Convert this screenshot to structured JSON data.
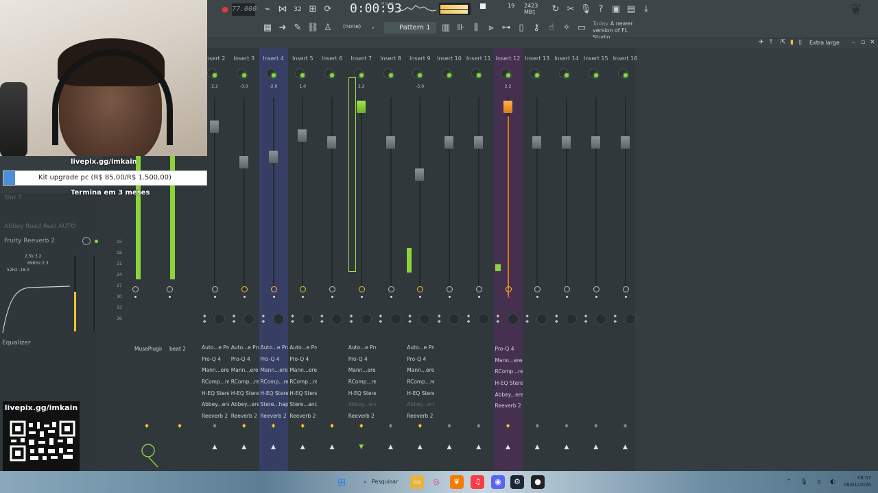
{
  "toolbar": {
    "tempo": "77.000",
    "pattern_number": "32",
    "time": "0:00:93",
    "time_label": "M:S:CS",
    "cpu_value": "19",
    "memory": "2423 MB",
    "polyphony": "1",
    "none_label": "(none)",
    "pattern": "Pattern 1",
    "news_today": "Today",
    "news_message": "A newer version of FL Studio..."
  },
  "mixer": {
    "zoom": "Extra large",
    "tracks": [
      {
        "name": "Insert 2",
        "pan": "2.2",
        "fx": [
          "MusePlugin"
        ],
        "dim_fx": [],
        "highlight": "",
        "fader": 0.78,
        "cap": "grey",
        "level": 0.62,
        "yellow_return": false,
        "yellow_send": true,
        "led": false
      },
      {
        "name": "Insert 3",
        "pan": "-3.0",
        "fx": [
          "beat 2"
        ],
        "dim_fx": [],
        "highlight": "",
        "fader": 0.65,
        "cap": "grey",
        "level": 0.62,
        "yellow_return": false,
        "yellow_send": true,
        "led": true
      },
      {
        "name": "Insert 4",
        "pan": "-2.0",
        "fx": [
          "Auto...e Pro",
          "Pro-Q 4",
          "Mann...ereo",
          "RComp...reo",
          "H-EQ Stereo",
          "Abbey...ereo",
          "Reeverb 2"
        ],
        "dim_fx": [],
        "highlight": "blue",
        "fader": 0.68,
        "cap": "grey",
        "level": 0,
        "yellow_return": true,
        "yellow_send": true,
        "led": true
      },
      {
        "name": "Insert 5",
        "pan": "1.0",
        "fx": [
          "Auto...e Pro",
          "Pro-Q 4",
          "Mann...ereo",
          "RComp...reo",
          "H-EQ Stereo",
          "Abbey...ereo",
          "Reeverb 2"
        ],
        "dim_fx": [],
        "highlight": "",
        "fader": 0.75,
        "cap": "grey",
        "level": 0,
        "yellow_return": true,
        "yellow_send": true,
        "led": true
      },
      {
        "name": "Insert 6",
        "pan": "",
        "fx": [
          "Auto...e Pro",
          "Pro-Q 4",
          "Mann...ereo",
          "RComp...reo",
          "H-EQ Stereo",
          "Stere...haper",
          "Reeverb 2"
        ],
        "dim_fx": [],
        "highlight": "",
        "fader": 0.75,
        "cap": "grey",
        "level": 0,
        "yellow_return": true,
        "yellow_send": true,
        "led": true
      },
      {
        "name": "Insert 7",
        "pan": "2.2",
        "fx": [
          "Auto...e Pro",
          "Pro-Q 4",
          "Mann...ereo",
          "RComp...reo",
          "H-EQ Stereo",
          "Stere...ancer",
          "Reeverb 2"
        ],
        "dim_fx": [],
        "highlight": "",
        "fader": 0.9,
        "cap": "green",
        "level": 0,
        "yellow_return": true,
        "yellow_send": true,
        "led": true
      }
    ]
  },
  "strips": [
    {
      "name": "Insert 2",
      "pan": "2.2"
    },
    {
      "name": "Insert 3",
      "pan": "-3.0"
    },
    {
      "name": "Insert 4",
      "pan": "-2.0"
    },
    {
      "name": "Insert 5",
      "pan": "1.0"
    },
    {
      "name": "Insert 6",
      "pan": ""
    },
    {
      "name": "Insert 7",
      "pan": "2.2"
    },
    {
      "name": "Insert 8",
      "pan": ""
    },
    {
      "name": "Insert 9",
      "pan": "-5.0"
    },
    {
      "name": "Insert 10",
      "pan": ""
    },
    {
      "name": "Insert 11",
      "pan": ""
    },
    {
      "name": "Insert 12",
      "pan": "2.2"
    },
    {
      "name": "Insert 13",
      "pan": ""
    },
    {
      "name": "Insert 14",
      "pan": ""
    },
    {
      "name": "Insert 15",
      "pan": ""
    },
    {
      "name": "Insert 16",
      "pan": ""
    }
  ],
  "fx_columns": {
    "col0": [
      "MusePlugin"
    ],
    "col1": [
      "beat 2"
    ],
    "col2": [
      "Auto...e Pro",
      "Pro-Q 4",
      "Mann...ereo",
      "RComp...reo",
      "H-EQ Stereo",
      "Abbey...ereo",
      "Reeverb 2"
    ],
    "col3": [
      "Auto...e Pro",
      "Pro-Q 4",
      "Mann...ereo",
      "RComp...reo",
      "H-EQ Stereo",
      "Abbey...ereo",
      "Reeverb 2"
    ],
    "col4": [
      "Auto...e Pro",
      "Pro-Q 4",
      "Mann...ereo",
      "RComp...reo",
      "H-EQ Stereo",
      "Stere...haper",
      "Reeverb 2"
    ],
    "col5": [
      "Auto...e Pro",
      "Pro-Q 4",
      "Mann...ereo",
      "RComp...reo",
      "H-EQ Stereo",
      "Stere...ancer",
      "Reeverb 2"
    ],
    "col7": [
      "Auto...e Pro",
      "Pro-Q 4",
      "Mann...ereo",
      "RComp...reo",
      "H-EQ Stereo",
      "Abbey...ereo",
      "Reeverb 2"
    ],
    "col9": [
      "Auto...e Pro",
      "Pro-Q 4",
      "Mann...ereo",
      "RComp...reo",
      "H-EQ Stereo",
      "Abbey...ereo",
      "Reeverb 2"
    ],
    "col13": [
      "Pro-Q 4",
      "Mann...ereo",
      "RComp...reo",
      "H-EQ Stereo",
      "Abbey...ereo",
      "Reeverb 2"
    ]
  },
  "left_panel": {
    "slot7": "Slot 7",
    "slot_abbey": "Abbey Road Reel AUTO",
    "slot_reverb": "Fruity Reeverb 2",
    "eq_line1": "2.5k  3.2",
    "eq_line2": "696Hz  2.3",
    "eq_line3": "52Hz  -18.0",
    "equalizer": "Equalizer",
    "scale": [
      "15",
      "18",
      "21",
      "24",
      "27",
      "30",
      "33",
      "36"
    ]
  },
  "overlay": {
    "url": "livepix.gg/imkain",
    "goal": "Kit upgrade pc (R$ 85,00/R$ 1.500,00)",
    "goal_progress": 0.057,
    "ends": "Termina em 3 meses",
    "qr_title": "livepix.gg/imkain"
  },
  "taskbar": {
    "search": "Pesquisar",
    "time": "08:57",
    "date": "08/01/2026"
  },
  "colors": {
    "accent_green": "#8dd43a",
    "accent_orange": "#e07a17",
    "blue_track": "#363f63",
    "purple_track": "#453050",
    "record": "#e53935"
  }
}
